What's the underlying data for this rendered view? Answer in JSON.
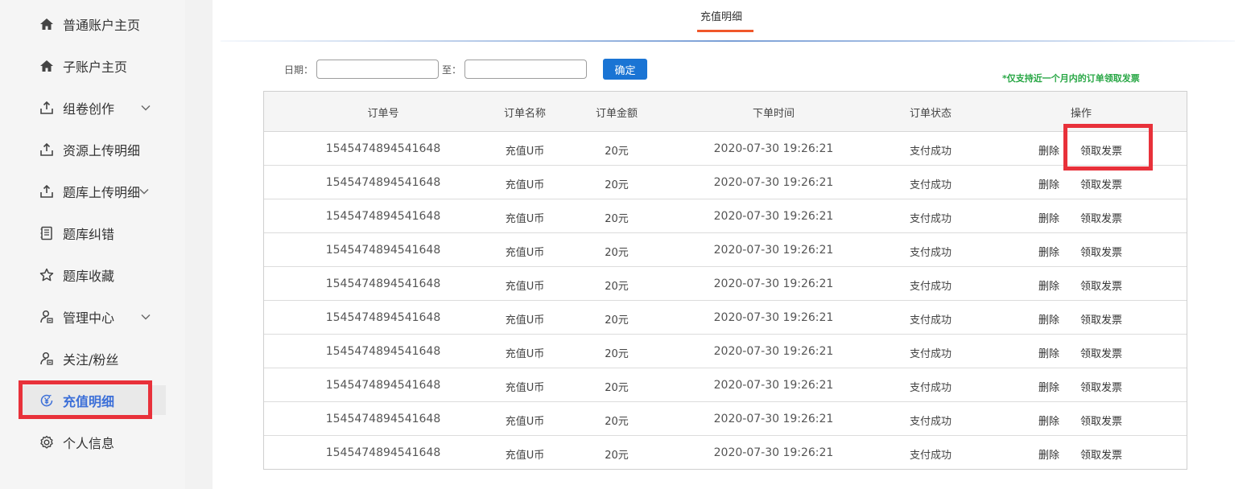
{
  "sidebar": {
    "items": [
      {
        "label": "普通账户主页",
        "icon": "home-icon",
        "chevron": false
      },
      {
        "label": "子账户主页",
        "icon": "home-icon",
        "chevron": false
      },
      {
        "label": "组卷创作",
        "icon": "upload-icon",
        "chevron": true
      },
      {
        "label": "资源上传明细",
        "icon": "upload-icon",
        "chevron": false
      },
      {
        "label": "题库上传明细",
        "icon": "upload-icon",
        "chevron": true
      },
      {
        "label": "题库纠错",
        "icon": "notebook-icon",
        "chevron": false
      },
      {
        "label": "题库收藏",
        "icon": "star-icon",
        "chevron": false
      },
      {
        "label": "管理中心",
        "icon": "user-manage-icon",
        "chevron": true
      },
      {
        "label": "关注/粉丝",
        "icon": "user-manage-icon",
        "chevron": false
      },
      {
        "label": "充值明细",
        "icon": "yen-circle-icon",
        "chevron": false,
        "active": true
      },
      {
        "label": "个人信息",
        "icon": "gear-icon",
        "chevron": false
      }
    ]
  },
  "tab": {
    "label": "充值明细"
  },
  "filter": {
    "date_label": "日期：",
    "to_label": "至：",
    "start_value": "",
    "end_value": "",
    "confirm_label": "确定"
  },
  "notice": "*仅支持近一个月内的订单领取发票",
  "table": {
    "headers": [
      "订单号",
      "订单名称",
      "订单金额",
      "下单时间",
      "订单状态",
      "操作"
    ],
    "rows": [
      {
        "order_no": "1545474894541648",
        "name": "充值U币",
        "amount": "20元",
        "time": "2020-07-30 19:26:21",
        "status": "支付成功",
        "delete": "删除",
        "invoice": "领取发票"
      },
      {
        "order_no": "1545474894541648",
        "name": "充值U币",
        "amount": "20元",
        "time": "2020-07-30 19:26:21",
        "status": "支付成功",
        "delete": "删除",
        "invoice": "领取发票"
      },
      {
        "order_no": "1545474894541648",
        "name": "充值U币",
        "amount": "20元",
        "time": "2020-07-30 19:26:21",
        "status": "支付成功",
        "delete": "删除",
        "invoice": "领取发票"
      },
      {
        "order_no": "1545474894541648",
        "name": "充值U币",
        "amount": "20元",
        "time": "2020-07-30 19:26:21",
        "status": "支付成功",
        "delete": "删除",
        "invoice": "领取发票"
      },
      {
        "order_no": "1545474894541648",
        "name": "充值U币",
        "amount": "20元",
        "time": "2020-07-30 19:26:21",
        "status": "支付成功",
        "delete": "删除",
        "invoice": "领取发票"
      },
      {
        "order_no": "1545474894541648",
        "name": "充值U币",
        "amount": "20元",
        "time": "2020-07-30 19:26:21",
        "status": "支付成功",
        "delete": "删除",
        "invoice": "领取发票"
      },
      {
        "order_no": "1545474894541648",
        "name": "充值U币",
        "amount": "20元",
        "time": "2020-07-30 19:26:21",
        "status": "支付成功",
        "delete": "删除",
        "invoice": "领取发票"
      },
      {
        "order_no": "1545474894541648",
        "name": "充值U币",
        "amount": "20元",
        "time": "2020-07-30 19:26:21",
        "status": "支付成功",
        "delete": "删除",
        "invoice": "领取发票"
      },
      {
        "order_no": "1545474894541648",
        "name": "充值U币",
        "amount": "20元",
        "time": "2020-07-30 19:26:21",
        "status": "支付成功",
        "delete": "删除",
        "invoice": "领取发票"
      },
      {
        "order_no": "1545474894541648",
        "name": "充值U币",
        "amount": "20元",
        "time": "2020-07-30 19:26:21",
        "status": "支付成功",
        "delete": "删除",
        "invoice": "领取发票"
      }
    ]
  },
  "colors": {
    "accent": "#1a74d4",
    "active_nav": "#3c6fd8",
    "tab_underline": "#f0572a",
    "highlight_box": "#e8313a",
    "notice": "#28a745"
  }
}
